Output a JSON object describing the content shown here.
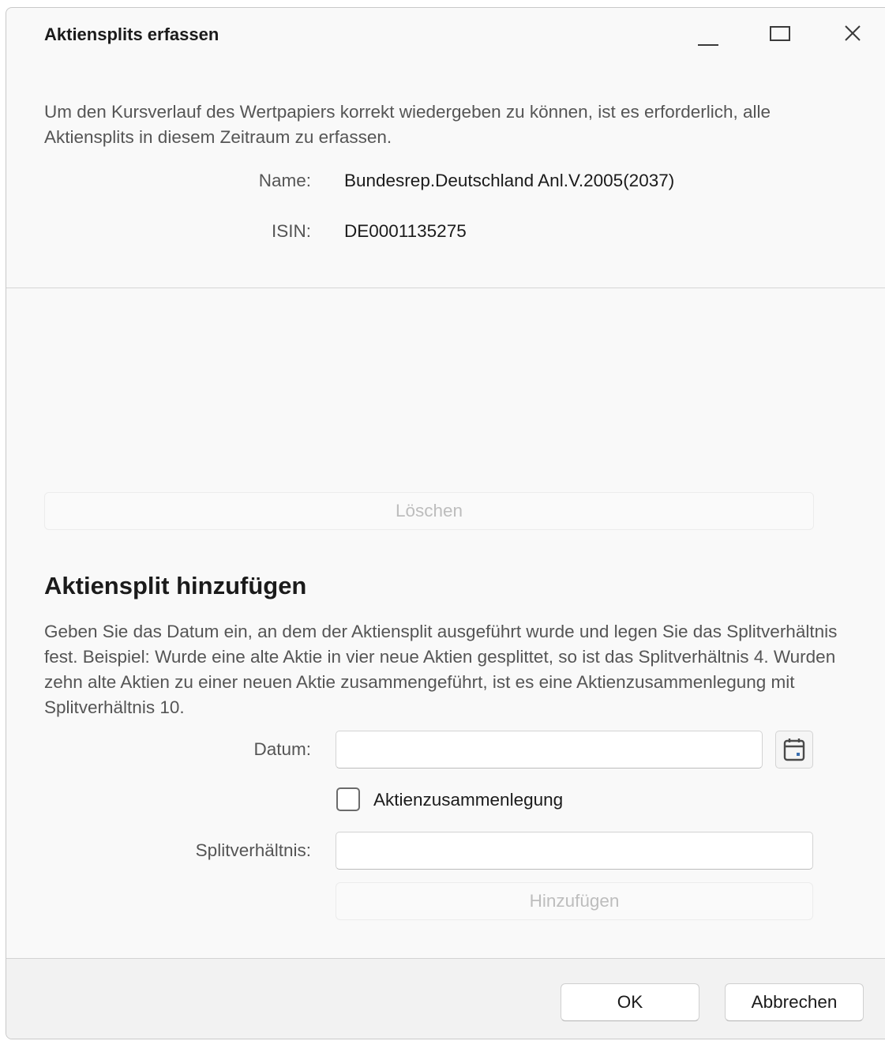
{
  "window": {
    "title": "Aktiensplits erfassen"
  },
  "intro": {
    "text": "Um den Kursverlauf des Wertpapiers korrekt wiedergeben zu können, ist es erforderlich, alle Aktiensplits in diesem Zeitraum zu erfassen."
  },
  "security": {
    "name_label": "Name:",
    "name_value": "Bundesrep.Deutschland Anl.V.2005(2037)",
    "isin_label": "ISIN:",
    "isin_value": "DE0001135275"
  },
  "list": {
    "delete_label": "Löschen"
  },
  "add_section": {
    "heading": "Aktiensplit hinzufügen",
    "help": "Geben Sie das Datum ein, an dem der Aktiensplit ausgeführt wurde und legen Sie das Splitverhältnis fest. Beispiel: Wurde eine alte Aktie in vier neue Aktien gesplittet, so ist das Splitverhältnis 4. Wurden zehn alte Aktien zu einer neuen Aktie zusammengeführt, ist es eine Aktienzusammenlegung mit Splitverhältnis 10.",
    "date_label": "Datum:",
    "date_value": "",
    "merge_label": "Aktienzusammenlegung",
    "merge_checked": false,
    "ratio_label": "Splitverhältnis:",
    "ratio_value": "",
    "add_label": "Hinzufügen"
  },
  "footer": {
    "ok_label": "OK",
    "cancel_label": "Abbrechen"
  },
  "icons": {
    "minimize": "minimize-icon",
    "maximize": "maximize-icon",
    "close": "close-icon",
    "calendar": "calendar-icon"
  }
}
